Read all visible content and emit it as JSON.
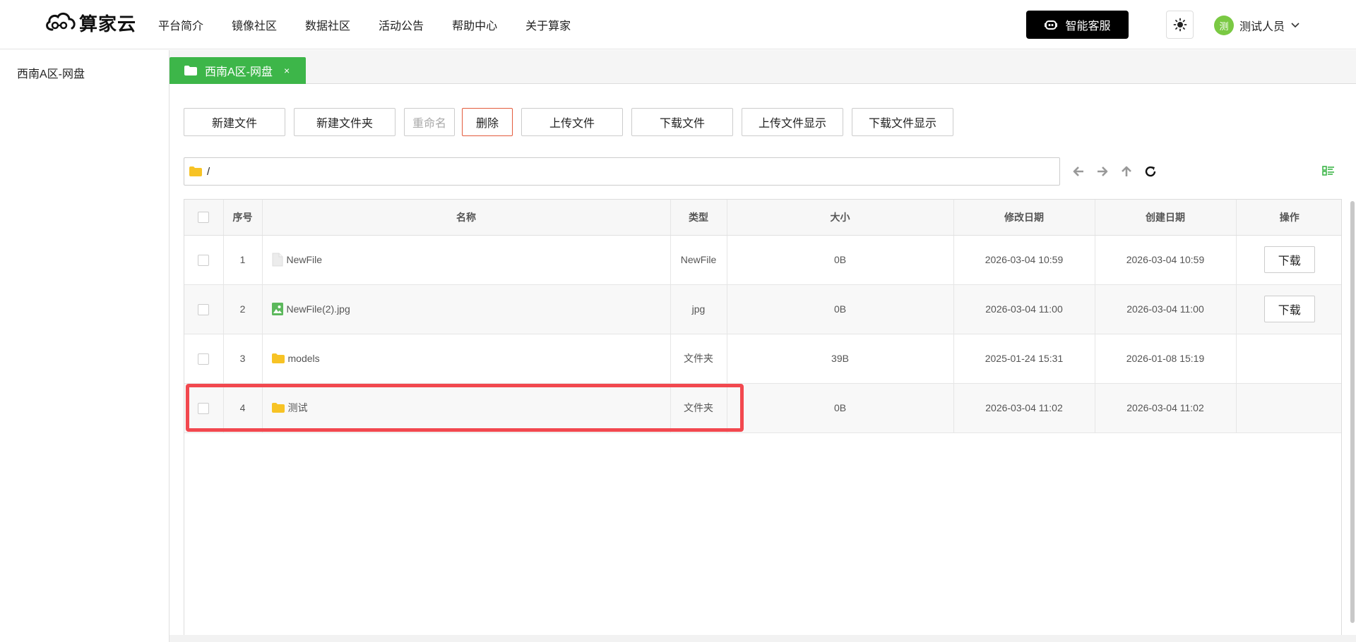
{
  "header": {
    "brand": "算家云",
    "nav": [
      "平台简介",
      "镜像社区",
      "数据社区",
      "活动公告",
      "帮助中心",
      "关于算家"
    ],
    "service_label": "智能客服",
    "user": {
      "avatar_text": "测",
      "name": "测试人员"
    }
  },
  "sidebar": {
    "items": [
      "西南A区-网盘"
    ]
  },
  "tab": {
    "label": "西南A区-网盘",
    "close": "×"
  },
  "toolbar": {
    "buttons": [
      "新建文件",
      "新建文件夹",
      "重命名",
      "删除",
      "上传文件",
      "下载文件",
      "上传文件显示",
      "下载文件显示"
    ]
  },
  "path": {
    "value": "/"
  },
  "table": {
    "headers": [
      "序号",
      "名称",
      "类型",
      "大小",
      "修改日期",
      "创建日期",
      "操作"
    ],
    "rows": [
      {
        "index": "1",
        "name": "NewFile",
        "icon": "file-icon",
        "type": "NewFile",
        "size": "0B",
        "modified": "2026-03-04 10:59",
        "created": "2026-03-04 10:59",
        "action": "下载"
      },
      {
        "index": "2",
        "name": "NewFile(2).jpg",
        "icon": "image-file-icon",
        "type": "jpg",
        "size": "0B",
        "modified": "2026-03-04 11:00",
        "created": "2026-03-04 11:00",
        "action": "下载"
      },
      {
        "index": "3",
        "name": "models",
        "icon": "folder-icon",
        "type": "文件夹",
        "size": "39B",
        "modified": "2025-01-24 15:31",
        "created": "2026-01-08 15:19",
        "action": ""
      },
      {
        "index": "4",
        "name": "测试",
        "icon": "folder-icon",
        "type": "文件夹",
        "size": "0B",
        "modified": "2026-03-04 11:02",
        "created": "2026-03-04 11:02",
        "action": ""
      }
    ]
  },
  "colors": {
    "accent": "#3db649",
    "highlight": "#f2484f",
    "folder": "#f7c325",
    "danger_border": "#e35b3c"
  }
}
